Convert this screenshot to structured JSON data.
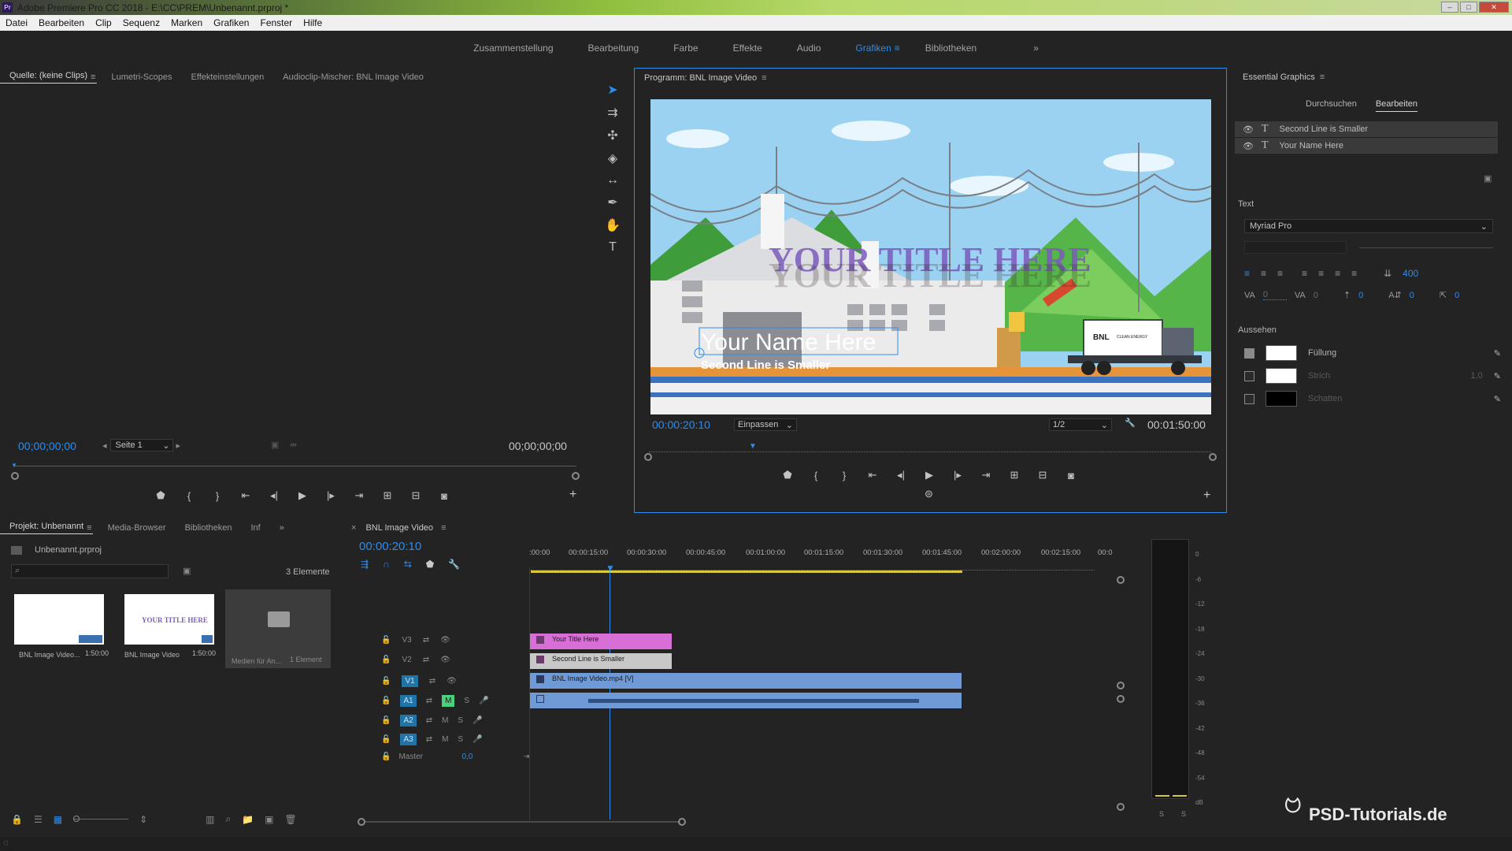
{
  "app": {
    "title": "Adobe Premiere Pro CC 2018 - E:\\CC\\PREM\\Unbenannt.prproj *",
    "logo": "Pr"
  },
  "menu": [
    "Datei",
    "Bearbeiten",
    "Clip",
    "Sequenz",
    "Marken",
    "Grafiken",
    "Fenster",
    "Hilfe"
  ],
  "workspaces": {
    "items": [
      "Zusammenstellung",
      "Bearbeitung",
      "Farbe",
      "Effekte",
      "Audio",
      "Grafiken",
      "Bibliotheken"
    ],
    "active": "Grafiken",
    "more": "»"
  },
  "source_panel": {
    "tabs": [
      "Quelle: (keine Clips)",
      "Lumetri-Scopes",
      "Effekteinstellungen",
      "Audioclip-Mischer: BNL Image Video"
    ],
    "timecode_left": "00;00;00;00",
    "page_select": "Seite 1",
    "timecode_right": "00;00;00;00"
  },
  "program_panel": {
    "title": "Programm: BNL Image Video",
    "timecode": "00:00:20:10",
    "fit_select": "Einpassen",
    "quality_select": "1/2",
    "duration": "00:01:50:00",
    "overlay": {
      "title_text": "YOUR TITLE HERE",
      "name_text": "Your Name Here",
      "second_line_text": "Second Line is Smaller",
      "truck_text": "BNL",
      "truck_sub": "CLEAN ENERGY"
    }
  },
  "project_panel": {
    "tabs": [
      "Projekt: Unbenannt",
      "Media-Browser",
      "Bibliotheken",
      "Inf"
    ],
    "file": "Unbenannt.prproj",
    "count": "3 Elemente",
    "search_placeholder": "",
    "items": [
      {
        "name": "BNL Image Video...",
        "duration": "1:50:00"
      },
      {
        "name": "BNL Image Video",
        "duration": "1:50:00"
      },
      {
        "name": "Medien für An...",
        "duration": "1 Element"
      }
    ]
  },
  "timeline": {
    "tab": "BNL Image Video",
    "timecode": "00:00:20:10",
    "ruler": [
      ":00:00",
      "00:00:15:00",
      "00:00:30:00",
      "00:00:45:00",
      "00:01:00:00",
      "00:01:15:00",
      "00:01:30:00",
      "00:01:45:00",
      "00:02:00:00",
      "00:02:15:00",
      "00:0"
    ],
    "video_tracks": [
      "V3",
      "V2",
      "V1"
    ],
    "audio_tracks": [
      "A1",
      "A2",
      "A3"
    ],
    "master_label": "Master",
    "master_value": "0,0",
    "mute_label": "M",
    "solo_label": "S",
    "clips": {
      "v3": "Your Title Here",
      "v2": "Second Line is Smaller",
      "v1": "BNL Image Video.mp4 [V]"
    }
  },
  "audio_meter": {
    "scale": [
      "0",
      "-6",
      "-12",
      "-18",
      "-24",
      "-30",
      "-36",
      "-42",
      "-48",
      "-54",
      "dB"
    ],
    "solo_left": "S",
    "solo_right": "S"
  },
  "essential_graphics": {
    "title": "Essential Graphics",
    "tabs": [
      "Durchsuchen",
      "Bearbeiten"
    ],
    "active_tab": "Bearbeiten",
    "layers": [
      "Second Line is Smaller",
      "Your Name Here"
    ],
    "text_section": "Text",
    "font": "Myriad Pro",
    "leading": "400",
    "tracking": "0",
    "kerning": "0",
    "baseline": "0",
    "tsume": "0",
    "appearance_section": "Aussehen",
    "fill_label": "Füllung",
    "stroke_label": "Strich",
    "stroke_value": "1,0",
    "shadow_label": "Schatten",
    "fill_checked": true,
    "colors": {
      "fill": "#ffffff",
      "stroke": "#ffffff",
      "shadow": "#000000"
    }
  },
  "watermark": {
    "text": "PSD-Tutorials.de"
  },
  "colors": {
    "accent": "#2d8ceb",
    "panel_bg": "#232323",
    "clip_title": "#d86fd6",
    "clip_video": "#6f9ad6",
    "clip_graphic": "#c8c8c8",
    "track_active": "#1f74a8",
    "mute_on": "#4bd17a"
  }
}
